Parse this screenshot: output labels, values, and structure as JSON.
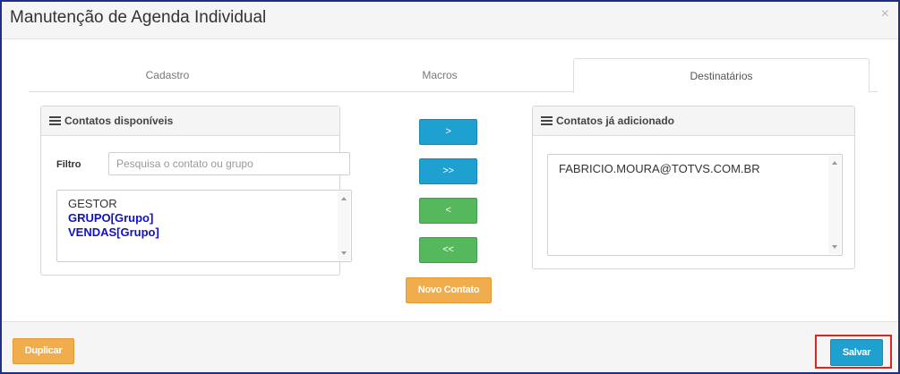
{
  "modal": {
    "title": "Manutenção de Agenda Individual",
    "close_glyph": "×"
  },
  "tabs": [
    {
      "label": "Cadastro",
      "active": false
    },
    {
      "label": "Macros",
      "active": false
    },
    {
      "label": "Destinatários",
      "active": true
    }
  ],
  "available": {
    "heading": "Contatos disponíveis",
    "filter_label": "Filtro",
    "filter_placeholder": "Pesquisa o contato ou grupo",
    "filter_value": "",
    "items": [
      {
        "label": "GESTOR",
        "type": "contact"
      },
      {
        "label": "GRUPO[Grupo]",
        "type": "group"
      },
      {
        "label": "VENDAS[Grupo]",
        "type": "group"
      }
    ]
  },
  "transfer": {
    "add_one": ">",
    "add_all": ">>",
    "remove_one": "<",
    "remove_all": "<<",
    "new_contact": "Novo Contato"
  },
  "added": {
    "heading": "Contatos já adicionado",
    "items": [
      {
        "label": "FABRICIO.MOURA@TOTVS.COM.BR"
      }
    ]
  },
  "footer": {
    "duplicate_label": "Duplicar",
    "save_label": "Salvar"
  },
  "colors": {
    "info": "#1ea1d1",
    "success": "#56b85c",
    "warning": "#f0ad4e",
    "group_text": "#1111cc",
    "highlight": "#e2231a",
    "frame": "#1f2f86"
  },
  "icons": {
    "close": "close-icon",
    "panel_heading": "list-icon"
  }
}
